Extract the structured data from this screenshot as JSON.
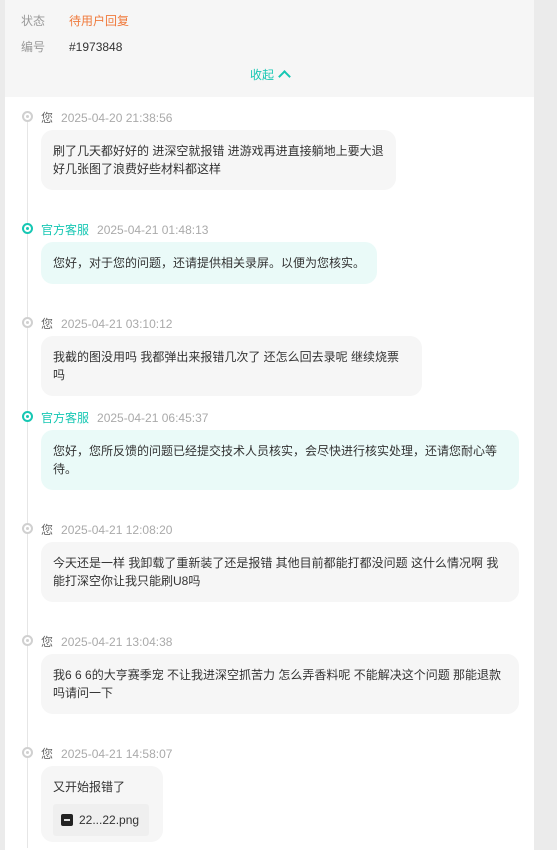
{
  "ticket": {
    "status_label": "状态",
    "status_value": "待用户回复",
    "number_label": "编号",
    "number_value": "#1973848",
    "collapse_label": "收起"
  },
  "colors": {
    "accent": "#16c7b3",
    "status": "#f07a3c"
  },
  "messages": [
    {
      "sender": "您",
      "time": "2025-04-20 21:38:56",
      "text": "刷了几天都好好的 进深空就报错 进游戏再进直接躺地上要大退好几张图了浪费好些材料都这样"
    },
    {
      "sender": "官方客服",
      "time": "2025-04-21 01:48:13",
      "text": "您好，对于您的问题，还请提供相关录屏。以便为您核实。"
    },
    {
      "sender": "您",
      "time": "2025-04-21 03:10:12",
      "text": "我截的图没用吗 我都弹出来报错几次了 还怎么回去录呢 继续烧票吗"
    },
    {
      "sender": "官方客服",
      "time": "2025-04-21 06:45:37",
      "text": "您好，您所反馈的问题已经提交技术人员核实，会尽快进行核实处理，还请您耐心等待。"
    },
    {
      "sender": "您",
      "time": "2025-04-21 12:08:20",
      "text": "今天还是一样 我卸载了重新装了还是报错 其他目前都能打都没问题 这什么情况啊 我能打深空你让我只能刷U8吗"
    },
    {
      "sender": "您",
      "time": "2025-04-21 13:04:38",
      "text": "我6 6 6的大亨赛季宠 不让我进深空抓苦力 怎么弄香料呢 不能解决这个问题 那能退款吗请问一下"
    },
    {
      "sender": "您",
      "time": "2025-04-21 14:58:07",
      "text": "又开始报错了",
      "attachment": "22...22.png"
    }
  ]
}
